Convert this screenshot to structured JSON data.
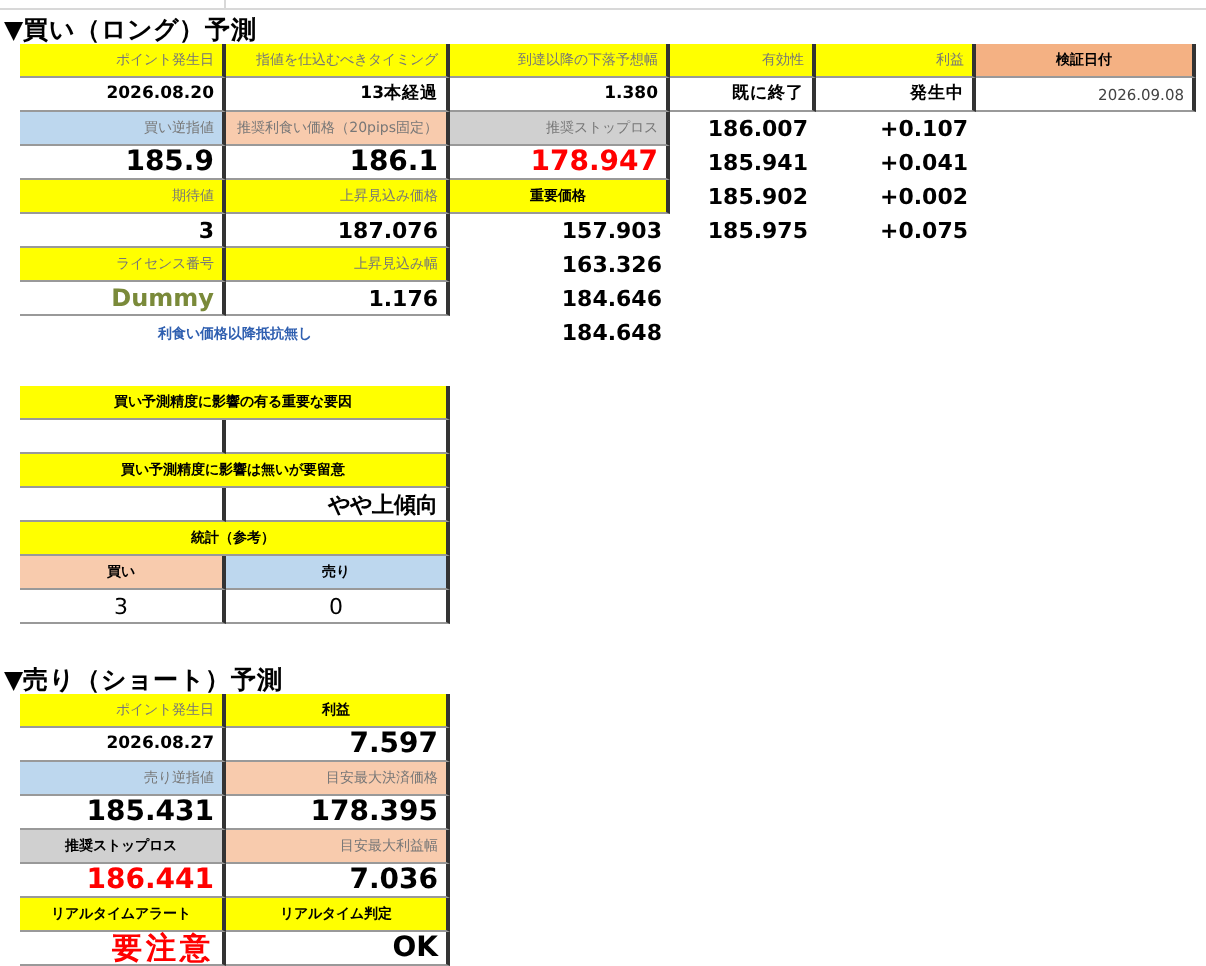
{
  "long_forecast": {
    "title": "▼買い（ロング）予測",
    "rows": [
      [
        {
          "text": "ポイント発生日",
          "color": "#ffff00",
          "kind": "label"
        },
        {
          "text": "指値を仕込むべきタイミング",
          "color": "#ffff00",
          "kind": "label"
        },
        {
          "text": "到達以降の下落予想幅",
          "color": "#ffff00",
          "kind": "label"
        },
        {
          "text": "有効性",
          "color": "#ffff00",
          "kind": "label"
        },
        {
          "text": "利益",
          "color": "#ffff00",
          "kind": "label"
        },
        {
          "text": "検証日付",
          "color": "#f4b183",
          "kind": "heading"
        }
      ],
      [
        {
          "text": "2026.08.20",
          "kind": "value"
        },
        {
          "text": "13本経過",
          "kind": "value"
        },
        {
          "text": "1.380",
          "kind": "value"
        },
        {
          "text": "既に終了",
          "kind": "value"
        },
        {
          "text": "発生中",
          "kind": "value"
        },
        {
          "text": "2026.09.08",
          "kind": "small"
        }
      ],
      [
        {
          "text": "買い逆指値",
          "color": "#bdd7ee",
          "kind": "label"
        },
        {
          "text": "推奨利食い価格（20pips固定）",
          "color": "#f8cbad",
          "kind": "label"
        },
        {
          "text": "推奨ストップロス",
          "color": "#d0d0d0",
          "kind": "label"
        },
        {
          "text": "186.007",
          "kind": "mid"
        },
        {
          "text": "+0.107",
          "kind": "mid"
        }
      ],
      [
        {
          "text": "185.9",
          "kind": "number"
        },
        {
          "text": "186.1",
          "kind": "number"
        },
        {
          "text": "178.947",
          "kind": "warning"
        },
        {
          "text": "185.941",
          "kind": "mid"
        },
        {
          "text": "+0.041",
          "kind": "mid"
        }
      ],
      [
        {
          "text": "期待値",
          "color": "#ffff00",
          "kind": "label"
        },
        {
          "text": "上昇見込み価格",
          "color": "#ffff00",
          "kind": "label"
        },
        {
          "text": "重要価格",
          "color": "#ffff00",
          "kind": "heading"
        },
        {
          "text": "185.902",
          "kind": "mid"
        },
        {
          "text": "+0.002",
          "kind": "mid"
        }
      ],
      [
        {
          "text": "3",
          "kind": "mid"
        },
        {
          "text": "187.076",
          "kind": "mid"
        },
        {
          "text": "157.903",
          "kind": "mid"
        },
        {
          "text": "185.975",
          "kind": "mid"
        },
        {
          "text": "+0.075",
          "kind": "mid"
        }
      ],
      [
        {
          "text": "ライセンス番号",
          "color": "#ffff00",
          "kind": "label"
        },
        {
          "text": "上昇見込み幅",
          "color": "#ffff00",
          "kind": "label"
        },
        {
          "text": "163.326",
          "kind": "mid"
        }
      ],
      [
        {
          "text": "Dummy",
          "kind": "license"
        },
        {
          "text": "1.176",
          "kind": "mid"
        },
        {
          "text": "184.646",
          "kind": "mid"
        }
      ],
      [
        {
          "text": "利食い価格以降抵抗無し",
          "kind": "note",
          "colspan": 2
        },
        {
          "text": "184.648",
          "kind": "mid"
        }
      ]
    ]
  },
  "factors": {
    "rows": [
      [
        {
          "text": "買い予測精度に影響の有る重要な要因",
          "color": "#ffff00",
          "kind": "heading",
          "colspan": 2
        }
      ],
      [
        {
          "text": "",
          "kind": "plain"
        },
        {
          "text": "",
          "kind": "plain"
        }
      ],
      [
        {
          "text": "買い予測精度に影響は無いが要留意",
          "color": "#ffff00",
          "kind": "heading",
          "colspan": 2
        }
      ],
      [
        {
          "text": "",
          "kind": "plain"
        },
        {
          "text": "やや上傾向",
          "kind": "mid"
        }
      ],
      [
        {
          "text": "統計（参考）",
          "color": "#ffff00",
          "kind": "heading",
          "colspan": 2
        }
      ],
      [
        {
          "text": "買い",
          "color": "#f8cbad",
          "kind": "heading"
        },
        {
          "text": "売り",
          "color": "#bdd7ee",
          "kind": "heading"
        }
      ],
      [
        {
          "text": "3",
          "kind": "plain"
        },
        {
          "text": "0",
          "kind": "plain"
        }
      ]
    ]
  },
  "short_forecast": {
    "title": "▼売り（ショート）予測",
    "rows": [
      [
        {
          "text": "ポイント発生日",
          "color": "#ffff00",
          "kind": "label"
        },
        {
          "text": "利益",
          "color": "#ffff00",
          "kind": "heading"
        }
      ],
      [
        {
          "text": "2026.08.27",
          "kind": "value"
        },
        {
          "text": "7.597",
          "kind": "number"
        }
      ],
      [
        {
          "text": "売り逆指値",
          "color": "#bdd7ee",
          "kind": "label"
        },
        {
          "text": "目安最大決済価格",
          "color": "#f8cbad",
          "kind": "label"
        }
      ],
      [
        {
          "text": "185.431",
          "kind": "number"
        },
        {
          "text": "178.395",
          "kind": "number"
        }
      ],
      [
        {
          "text": "推奨ストップロス",
          "color": "#d0d0d0",
          "kind": "heading"
        },
        {
          "text": "目安最大利益幅",
          "color": "#f8cbad",
          "kind": "label"
        }
      ],
      [
        {
          "text": "186.441",
          "kind": "warning"
        },
        {
          "text": "7.036",
          "kind": "number"
        }
      ],
      [
        {
          "text": "リアルタイムアラート",
          "color": "#ffff00",
          "kind": "heading"
        },
        {
          "text": "リアルタイム判定",
          "color": "#ffff00",
          "kind": "heading"
        }
      ],
      [
        {
          "text": "要注意",
          "kind": "alert"
        },
        {
          "text": "OK",
          "kind": "number"
        }
      ]
    ]
  }
}
